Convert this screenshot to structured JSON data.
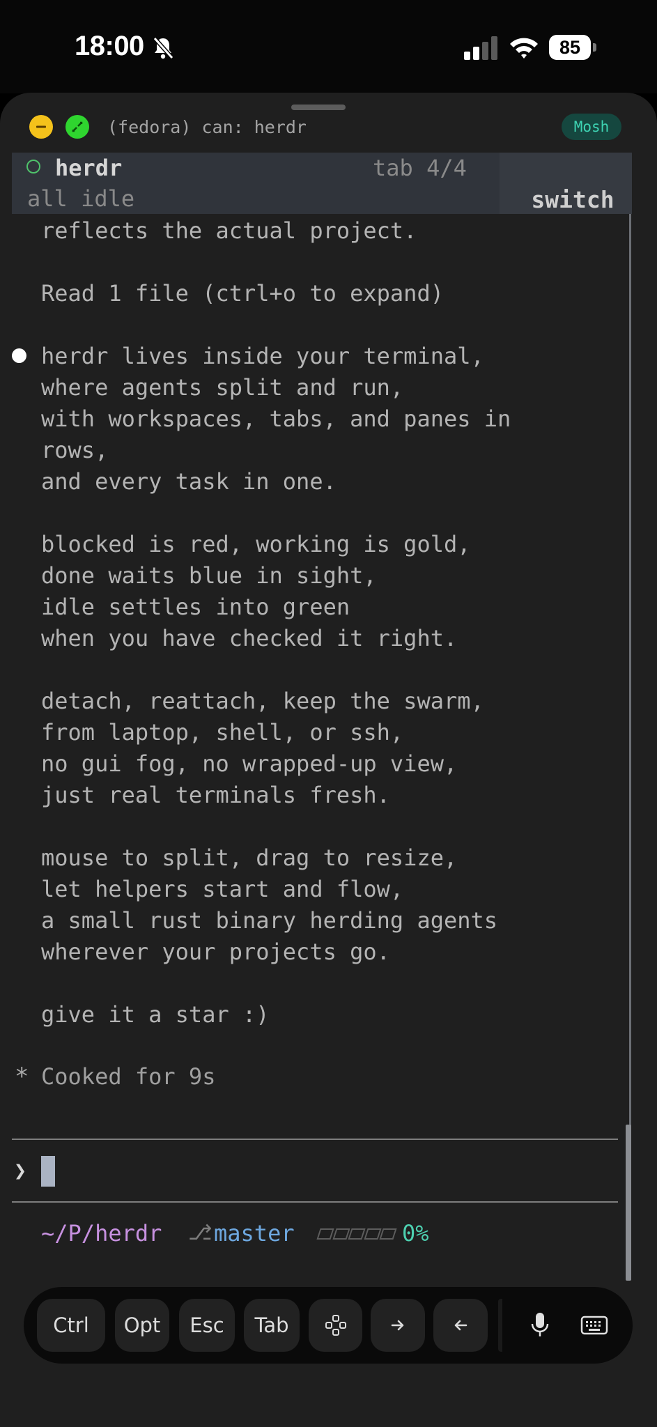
{
  "status_bar": {
    "time": "18:00",
    "battery": "85",
    "icons": [
      "bell-slash-icon",
      "cellular-signal-icon",
      "wifi-icon",
      "battery-icon"
    ]
  },
  "window": {
    "title": "(fedora) can: herdr",
    "badge": "Mosh",
    "buttons": [
      "minimize-button",
      "maximize-button"
    ]
  },
  "tabbar": {
    "name": "herdr",
    "count": "tab 4/4",
    "status": "all idle",
    "switch_label": "switch",
    "indicator_color": "#4fc26b"
  },
  "output": {
    "lines": [
      "reflects the actual project.",
      "",
      "Read 1 file (ctrl+o to expand)",
      "",
      "herdr lives inside your terminal,",
      "where agents split and run,",
      "with workspaces, tabs, and panes in",
      "rows,",
      "and every task in one.",
      "",
      "blocked is red, working is gold,",
      "done waits blue in sight,",
      "idle settles into green",
      "when you have checked it right.",
      "",
      "detach, reattach, keep the swarm,",
      "from laptop, shell, or ssh,",
      "no gui fog, no wrapped-up view,",
      "just real terminals fresh.",
      "",
      "mouse to split, drag to resize,",
      "let helpers start and flow,",
      "a small rust binary herding agents",
      "wherever your projects go.",
      "",
      "give it a star :)"
    ],
    "status_symbol": "*",
    "status_text": "Cooked for 9s"
  },
  "prompt": {
    "symbol": "❯"
  },
  "statusline": {
    "path": "~/P/herdr",
    "branch_icon": "⎇",
    "branch": "master",
    "progress_percent": 0,
    "progress_label": "0%",
    "colors": {
      "path": "#c791e0",
      "branch": "#6ea8e0",
      "percent": "#4dd0b0"
    }
  },
  "keybar": {
    "keys": [
      "Ctrl",
      "Opt",
      "Esc",
      "Tab"
    ],
    "icon_keys": [
      "gamepad-icon",
      "arrow-right-icon",
      "arrow-left-icon",
      "microphone-icon",
      "keyboard-icon"
    ]
  }
}
